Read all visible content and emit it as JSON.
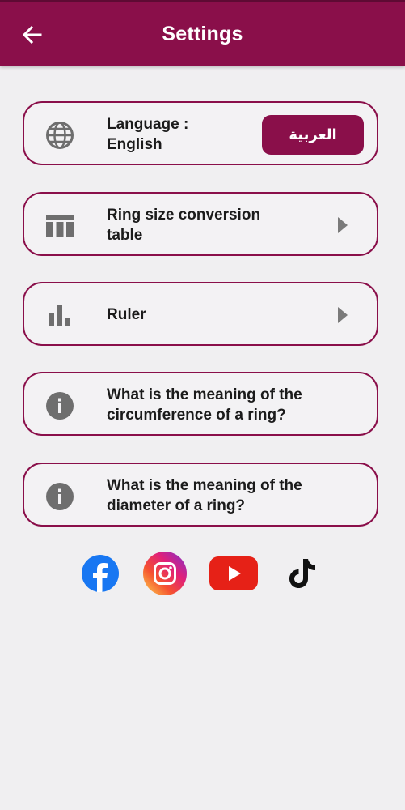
{
  "header": {
    "title": "Settings",
    "back_icon": "arrow-left-icon"
  },
  "settings": {
    "language_label": "Language : English",
    "language_button": "العربية",
    "ring_size_label": "Ring size conversion table",
    "ruler_label": "Ruler",
    "circumference_label": "What is the meaning of the circumference of a ring?",
    "diameter_label": "What is the meaning of the diameter of a ring?"
  },
  "icons": {
    "language": "globe-icon",
    "ring_size": "table-icon",
    "ruler": "bar-chart-icon",
    "info": "info-icon",
    "chevron": "chevron-right-icon"
  },
  "social": [
    "facebook-icon",
    "instagram-icon",
    "youtube-icon",
    "tiktok-icon"
  ],
  "colors": {
    "primary": "#8a0f4a",
    "background": "#f0eff1",
    "icon_gray": "#6e6e6e"
  }
}
